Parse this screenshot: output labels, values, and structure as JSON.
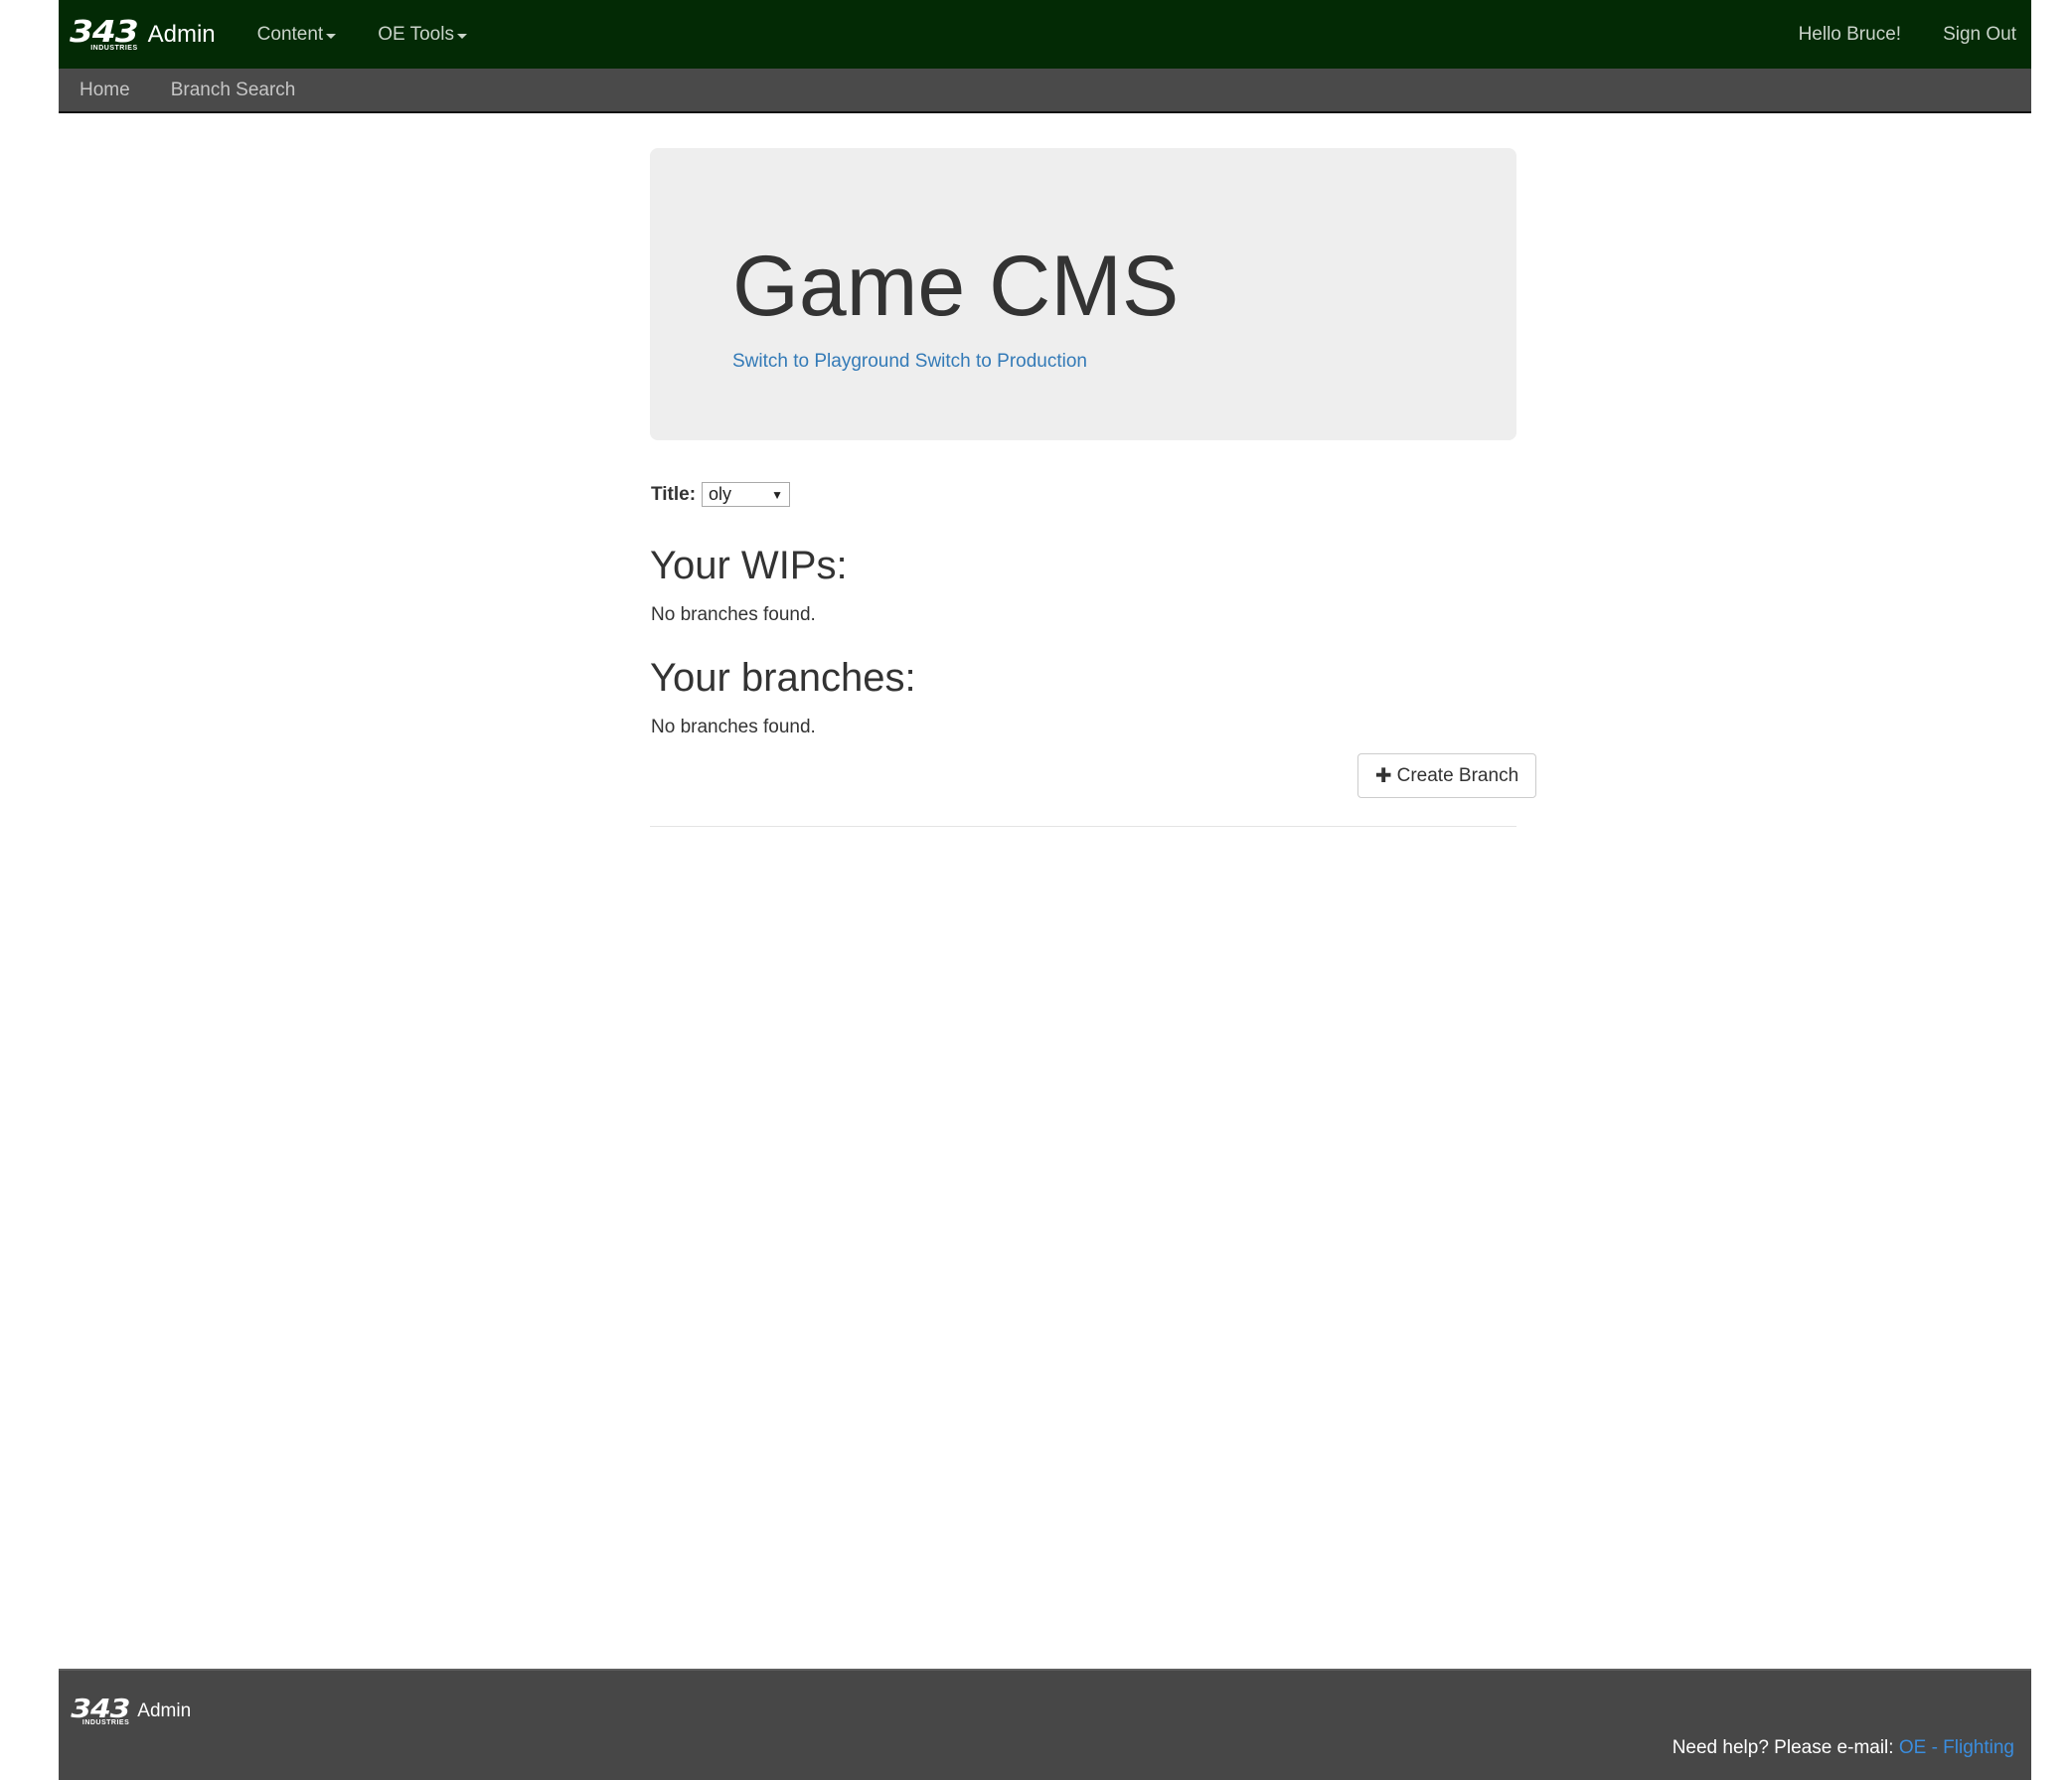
{
  "navbar": {
    "logo_number": "343",
    "logo_subtext": "INDUSTRIES",
    "brand": "Admin",
    "menus": [
      {
        "label": "Content"
      },
      {
        "label": "OE Tools"
      }
    ],
    "greeting": "Hello Bruce!",
    "signout": "Sign Out"
  },
  "subnav": {
    "items": [
      {
        "label": "Home"
      },
      {
        "label": "Branch Search"
      }
    ]
  },
  "jumbotron": {
    "title": "Game CMS",
    "link_playground": "Switch to Playground",
    "link_production": "Switch to Production"
  },
  "title_select": {
    "label": "Title:",
    "value": "oly"
  },
  "wips": {
    "heading": "Your WIPs:",
    "empty": "No branches found."
  },
  "branches": {
    "heading": "Your branches:",
    "empty": "No branches found.",
    "create_button": "Create Branch"
  },
  "footer": {
    "logo_number": "343",
    "logo_subtext": "INDUSTRIES",
    "brand": "Admin",
    "help_text": "Need help? Please e-mail:",
    "help_link": "OE - Flighting"
  },
  "colors": {
    "navbar_bg": "#032a05",
    "subnav_bg": "#4a4a4a",
    "footer_bg": "#474747",
    "link": "#337ab7",
    "footer_link": "#3a8dde"
  }
}
